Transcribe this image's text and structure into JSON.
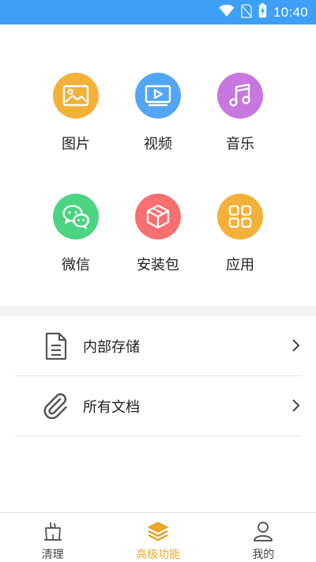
{
  "status_bar": {
    "time": "10:40",
    "color": "#3d9ff5"
  },
  "categories": [
    {
      "label": "图片",
      "icon": "image-icon",
      "color": "#f4b13a"
    },
    {
      "label": "视频",
      "icon": "video-icon",
      "color": "#52a6f5"
    },
    {
      "label": "音乐",
      "icon": "music-icon",
      "color": "#c777df"
    },
    {
      "label": "微信",
      "icon": "wechat-icon",
      "color": "#4cd483"
    },
    {
      "label": "安装包",
      "icon": "package-icon",
      "color": "#f76f6f"
    },
    {
      "label": "应用",
      "icon": "apps-icon",
      "color": "#f4b13a"
    }
  ],
  "list": [
    {
      "label": "内部存储",
      "icon": "document-icon"
    },
    {
      "label": "所有文档",
      "icon": "paperclip-icon"
    }
  ],
  "tabs": [
    {
      "label": "清理",
      "icon": "broom-icon",
      "active": false
    },
    {
      "label": "高级功能",
      "icon": "layers-icon",
      "active": true
    },
    {
      "label": "我的",
      "icon": "user-icon",
      "active": false
    }
  ],
  "accent_color": "#f0a92a"
}
